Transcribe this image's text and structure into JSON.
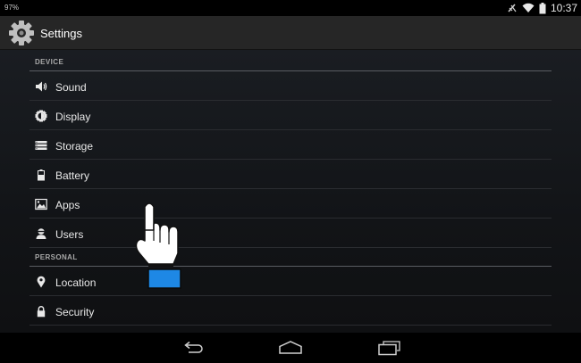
{
  "status_bar": {
    "battery_percent": "97%",
    "time": "10:37",
    "icons": [
      "signal-off-icon",
      "wifi-icon",
      "battery-icon"
    ]
  },
  "action_bar": {
    "title": "Settings",
    "icon": "settings-gear-icon"
  },
  "sections": [
    {
      "header": "DEVICE",
      "items": [
        {
          "label": "Sound",
          "icon": "speaker-icon"
        },
        {
          "label": "Display",
          "icon": "brightness-icon"
        },
        {
          "label": "Storage",
          "icon": "storage-icon"
        },
        {
          "label": "Battery",
          "icon": "battery-icon"
        },
        {
          "label": "Apps",
          "icon": "apps-icon"
        },
        {
          "label": "Users",
          "icon": "users-icon"
        }
      ]
    },
    {
      "header": "PERSONAL",
      "items": [
        {
          "label": "Location",
          "icon": "location-pin-icon"
        },
        {
          "label": "Security",
          "icon": "lock-icon"
        }
      ]
    }
  ],
  "nav_bar": {
    "buttons": [
      "back-icon",
      "home-icon",
      "recent-apps-icon"
    ]
  },
  "colors": {
    "action_bar": "#262626",
    "divider": "#5a5d62",
    "tap_indicator": "#1e88e5"
  }
}
